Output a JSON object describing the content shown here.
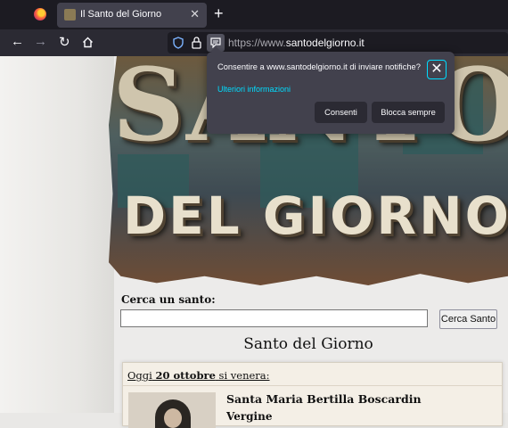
{
  "browser": {
    "tab_title": "Il Santo del Giorno",
    "tab_close": "✕",
    "new_tab": "+",
    "url_prefix": "https://www.",
    "url_domain": "santodelgiorno.it",
    "nav_icons": [
      "back-icon",
      "forward-icon",
      "reload-icon",
      "home-icon",
      "shield-icon",
      "lock-icon",
      "permissions-icon"
    ]
  },
  "notification": {
    "message": "Consentire a www.santodelgiorno.it di inviare notifiche?",
    "more_info": "Ulteriori informazioni",
    "close": "✕",
    "allow": "Consenti",
    "block": "Blocca sempre"
  },
  "banner": {
    "line1": "SANTO",
    "line2": "DEL GIORNO"
  },
  "search": {
    "label": "Cerca un santo:",
    "value": "",
    "button": "Cerca Santo"
  },
  "main": {
    "section_title": "Santo del Giorno",
    "today_prefix": "Oggi",
    "today_date": "20 ottobre",
    "today_suffix": "si venera:",
    "saint_name": "Santa Maria Bertilla Boscardin",
    "saint_sub": "Vergine"
  },
  "colors": {
    "chrome_bg": "#1c1b22",
    "tab_active": "#42414d",
    "accent": "#00ddff"
  }
}
